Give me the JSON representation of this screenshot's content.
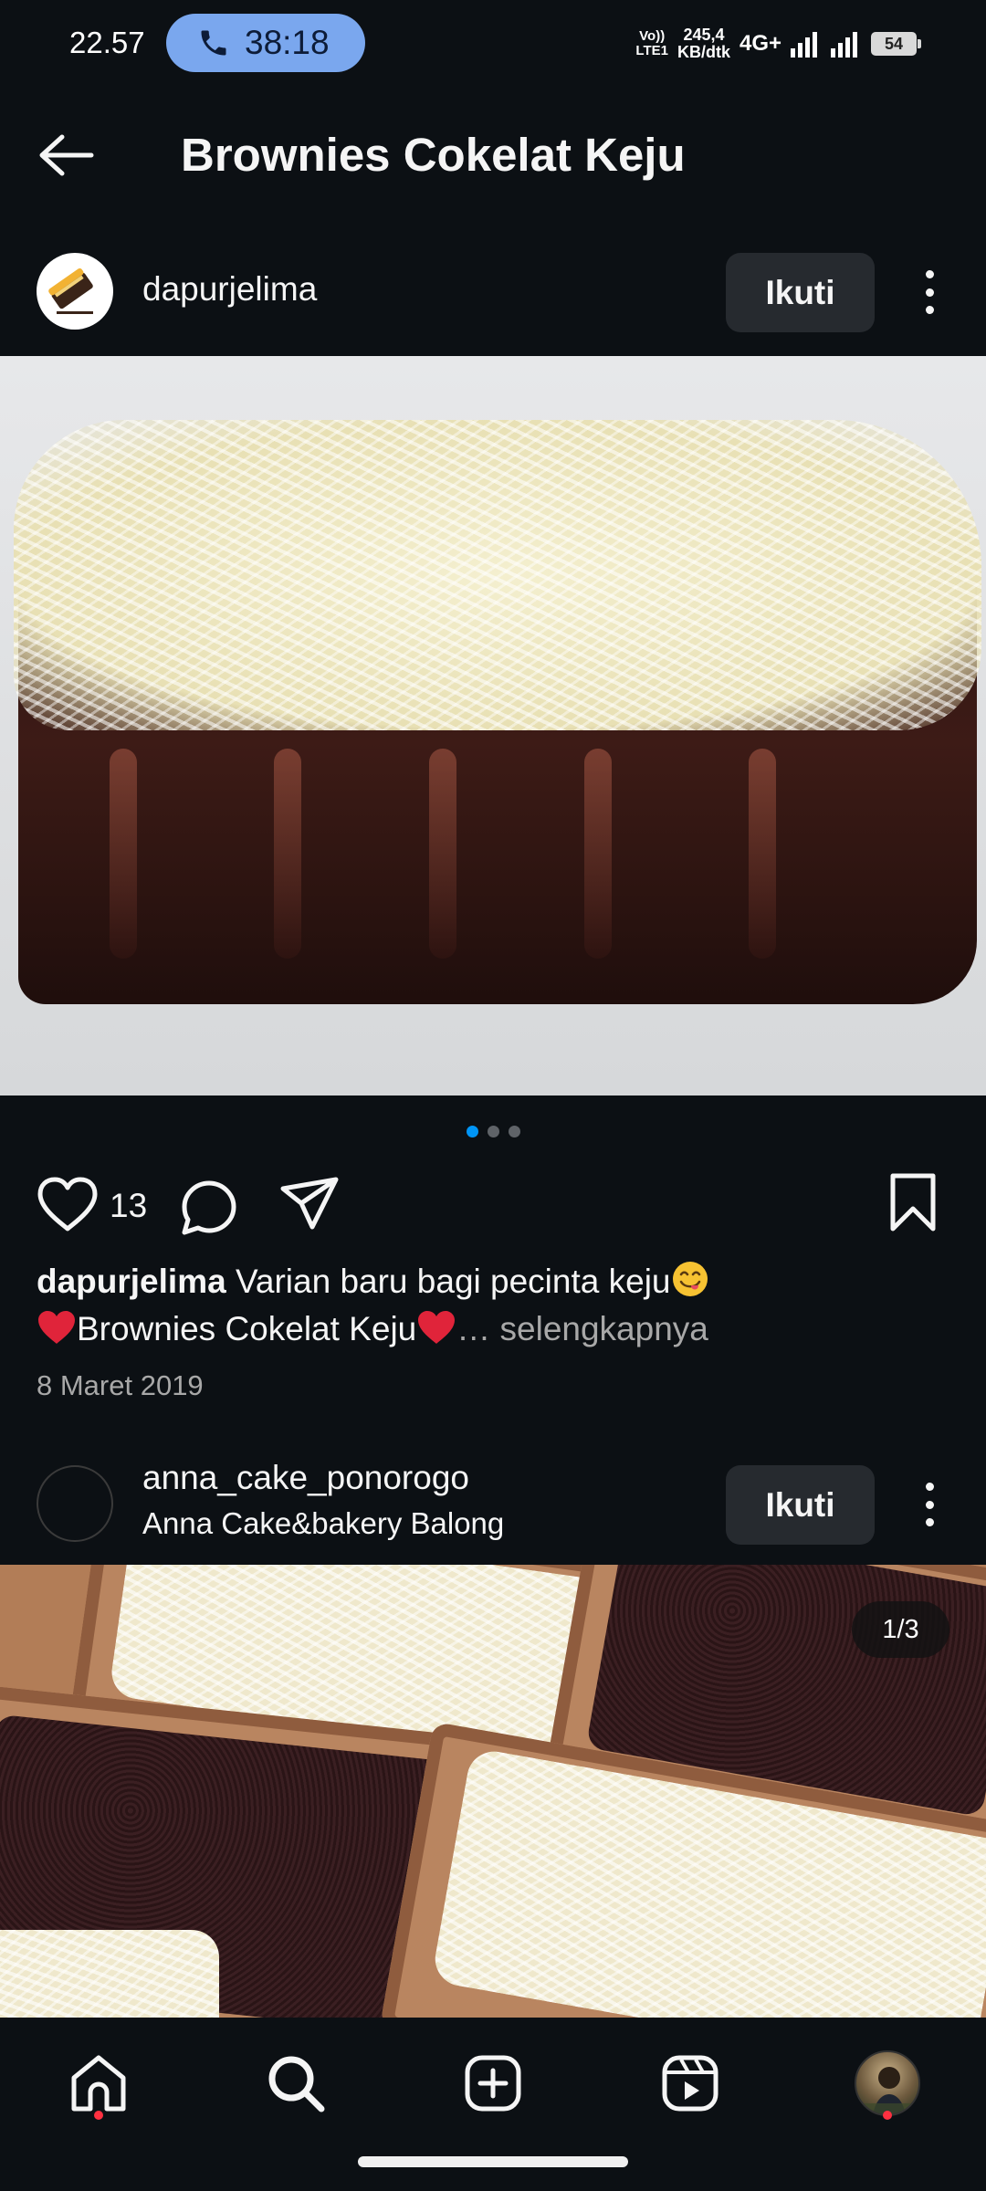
{
  "status_bar": {
    "time": "22.57",
    "call_timer": "38:18",
    "volte_top": "Vo))",
    "volte_bottom": "LTE1",
    "net_speed_value": "245,4",
    "net_speed_unit": "KB/dtk",
    "network": "4G+",
    "battery": "54"
  },
  "header": {
    "title": "Brownies Cokelat Keju"
  },
  "post1": {
    "username": "dapurjelima",
    "follow_label": "Ikuti",
    "likes": "13",
    "caption_username": "dapurjelima",
    "caption_line1": " Varian baru bagi pecinta keju",
    "caption_line2": "Brownies Cokelat Keju",
    "caption_more": "… selengkapnya",
    "date": "8 Maret 2019",
    "carousel_active_index": 0,
    "carousel_count": 3
  },
  "post2": {
    "username": "anna_cake_ponorogo",
    "location": "Anna Cake&bakery Balong",
    "follow_label": "Ikuti",
    "pager": "1/3"
  },
  "colors": {
    "background": "#0c1014",
    "accent_blue": "#0095f6",
    "call_pill": "#7aa7ee",
    "notification_red": "#ff3040"
  },
  "icons": {
    "back": "arrow-left",
    "like": "heart-outline",
    "comment": "speech-bubble",
    "share": "paper-plane",
    "save": "bookmark",
    "nav": [
      "home",
      "search",
      "add-post",
      "reels",
      "profile"
    ]
  }
}
